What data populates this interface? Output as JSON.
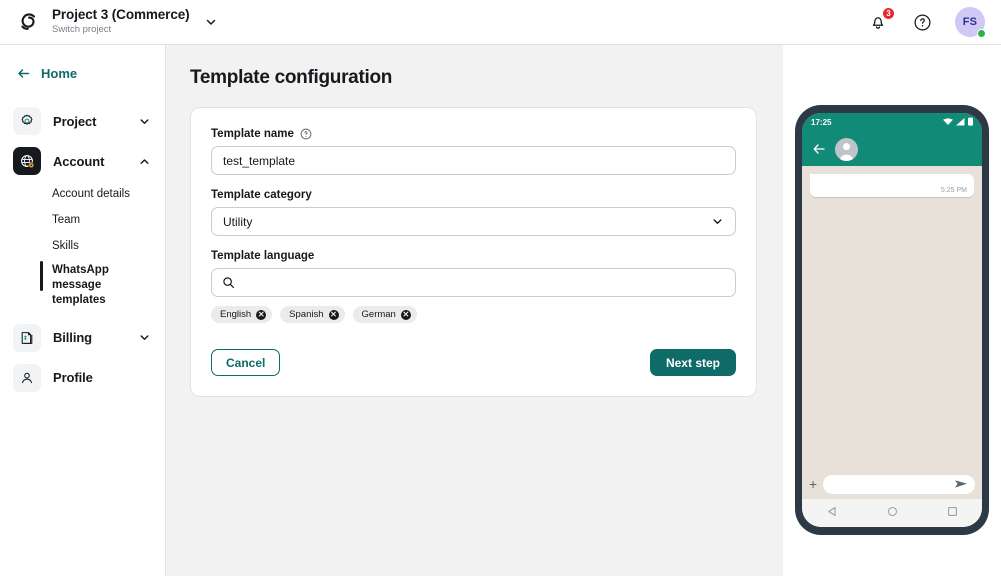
{
  "topbar": {
    "logo_icon": "brand-swirl-logo",
    "project_title": "Project 3 (Commerce)",
    "project_subtitle": "Switch project",
    "project_caret_icon": "chevron-down-icon",
    "notifications_icon": "bell-icon",
    "notifications_count": "3",
    "help_icon": "question-circle-icon",
    "avatar_initials": "FS",
    "avatar_status": "online"
  },
  "sidebar": {
    "back_icon": "arrow-left-icon",
    "home_label": "Home",
    "items": [
      {
        "label": "Project",
        "icon": "gear-icon",
        "caret": "chevron-down-icon",
        "active": false
      },
      {
        "label": "Account",
        "icon": "globe-gear-icon",
        "caret": "chevron-up-icon",
        "active": true
      },
      {
        "label": "Billing",
        "icon": "invoice-icon",
        "caret": "chevron-down-icon",
        "active": false
      },
      {
        "label": "Profile",
        "icon": "person-icon",
        "caret": "",
        "active": false
      }
    ],
    "account_subitems": [
      {
        "label": "Account details",
        "selected": false
      },
      {
        "label": "Team",
        "selected": false
      },
      {
        "label": "Skills",
        "selected": false
      },
      {
        "label": "WhatsApp message templates",
        "selected": true
      }
    ]
  },
  "main": {
    "page_title": "Template configuration",
    "fields": {
      "name": {
        "label": "Template name",
        "help_icon": "question-circle-icon",
        "value": "test_template",
        "placeholder": ""
      },
      "category": {
        "label": "Template category",
        "value": "Utility",
        "caret_icon": "chevron-down-icon"
      },
      "language": {
        "label": "Template language",
        "search_icon": "search-icon",
        "value": "",
        "placeholder": "",
        "chips": [
          {
            "label": "English",
            "remove_icon": "close-icon"
          },
          {
            "label": "Spanish",
            "remove_icon": "close-icon"
          },
          {
            "label": "German",
            "remove_icon": "close-icon"
          }
        ]
      }
    },
    "cancel_label": "Cancel",
    "next_label": "Next step"
  },
  "preview": {
    "status_time": "17:25",
    "status_icons": [
      "wifi-icon",
      "signal-icon",
      "battery-icon"
    ],
    "back_icon": "arrow-left-icon",
    "contact_avatar_icon": "person-avatar-icon",
    "message_time": "5:25 PM",
    "message_text": "",
    "compose_plus_icon": "plus-icon",
    "compose_placeholder": "",
    "send_icon": "send-icon",
    "nav_icons": [
      "back-triangle-icon",
      "home-circle-icon",
      "recents-square-icon"
    ]
  },
  "colors": {
    "accent_teal": "#0f6b68",
    "whatsapp_green": "#128a78",
    "badge_red": "#e8262d",
    "status_green": "#2fb344",
    "page_bg": "#f2f2f2"
  }
}
